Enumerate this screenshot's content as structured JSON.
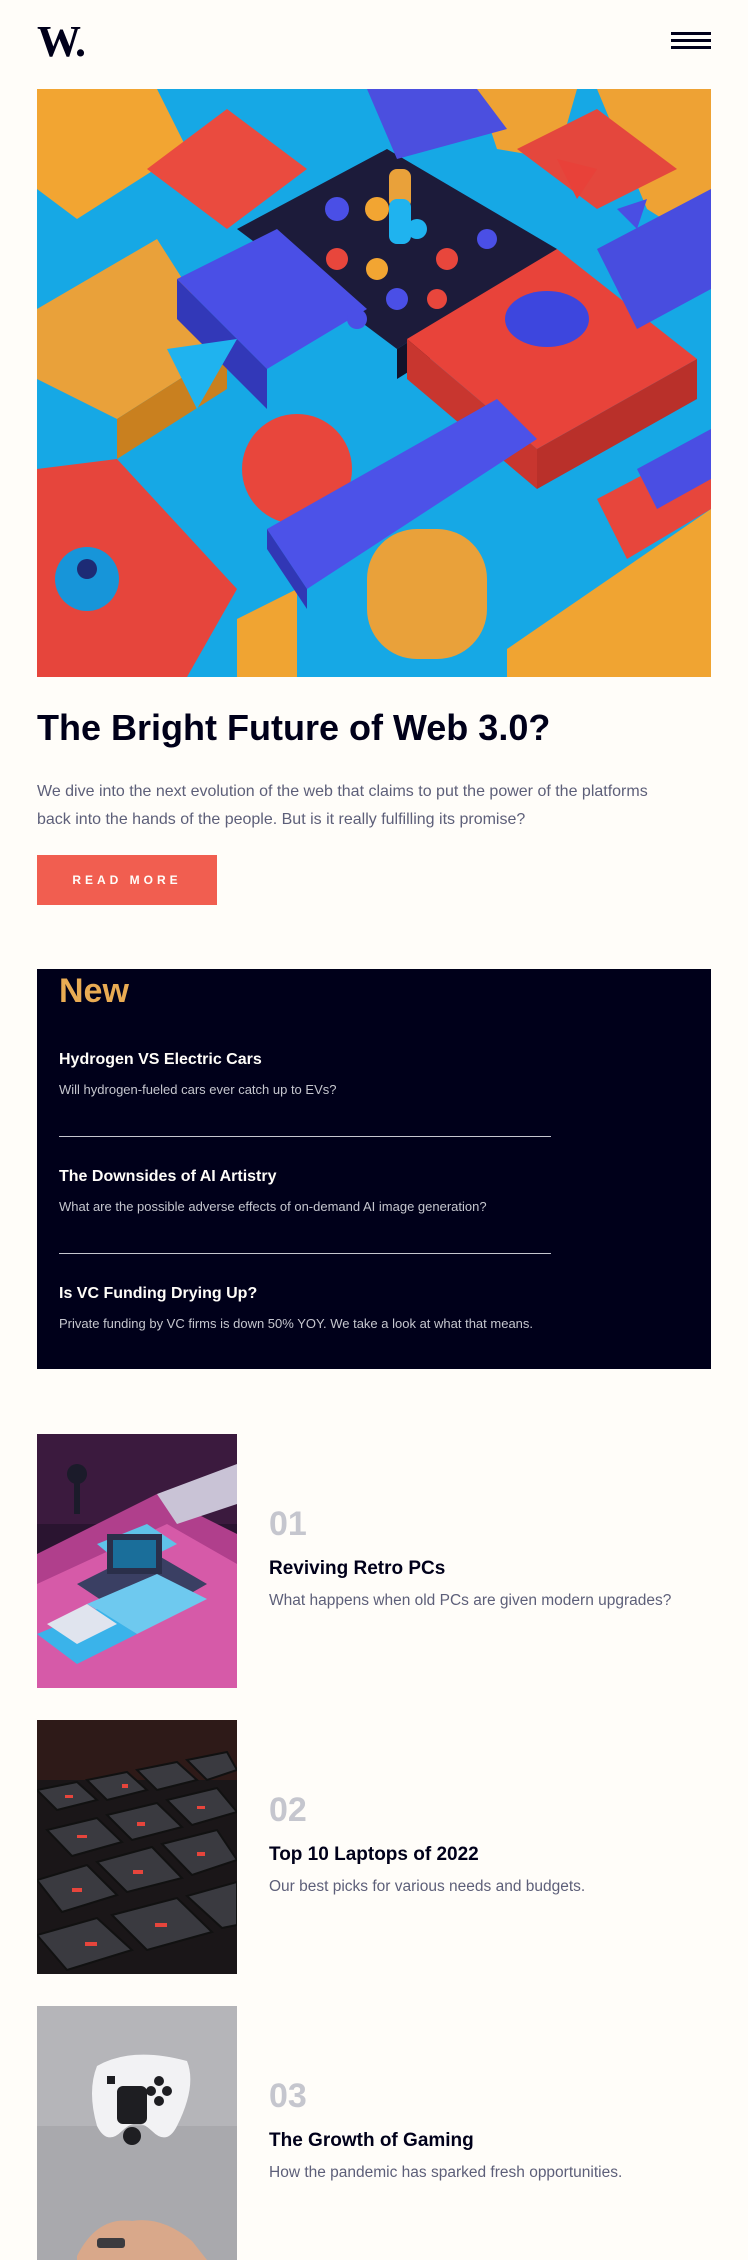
{
  "header": {
    "logo": "W.",
    "menu_icon": "hamburger-menu-icon"
  },
  "hero": {
    "image_icon": "colorful-3d-blocks-image",
    "title": "The Bright Future of Web 3.0?",
    "description": "We dive into the next evolution of the web that claims to put the power of the platforms back into the hands of the people. But is it really fulfilling its promise?",
    "button_label": "READ MORE"
  },
  "new_section": {
    "title": "New",
    "items": [
      {
        "title": "Hydrogen VS Electric Cars",
        "description": "Will hydrogen-fueled cars ever catch up to EVs?"
      },
      {
        "title": "The Downsides of AI Artistry",
        "description": "What are the possible adverse effects of on-demand AI image generation?"
      },
      {
        "title": "Is VC Funding Drying Up?",
        "description": "Private funding by VC firms is down 50% YOY. We take a look at what that means."
      }
    ]
  },
  "articles": [
    {
      "number": "01",
      "title": "Reviving Retro PCs",
      "description": "What happens when old PCs are given modern upgrades?",
      "image_icon": "retro-pc-image"
    },
    {
      "number": "02",
      "title": "Top 10 Laptops of 2022",
      "description": "Our best picks for various needs and budgets.",
      "image_icon": "laptop-keyboard-image"
    },
    {
      "number": "03",
      "title": "The Growth of Gaming",
      "description": "How the pandemic has sparked fresh opportunities.",
      "image_icon": "game-controller-image"
    }
  ],
  "colors": {
    "background": "#fffdf9",
    "dark_navy": "#00001a",
    "soft_orange": "#e9ab53",
    "soft_red": "#f15e50",
    "grayish_blue": "#5d5f79",
    "grayish_light": "#c5c6ce"
  }
}
